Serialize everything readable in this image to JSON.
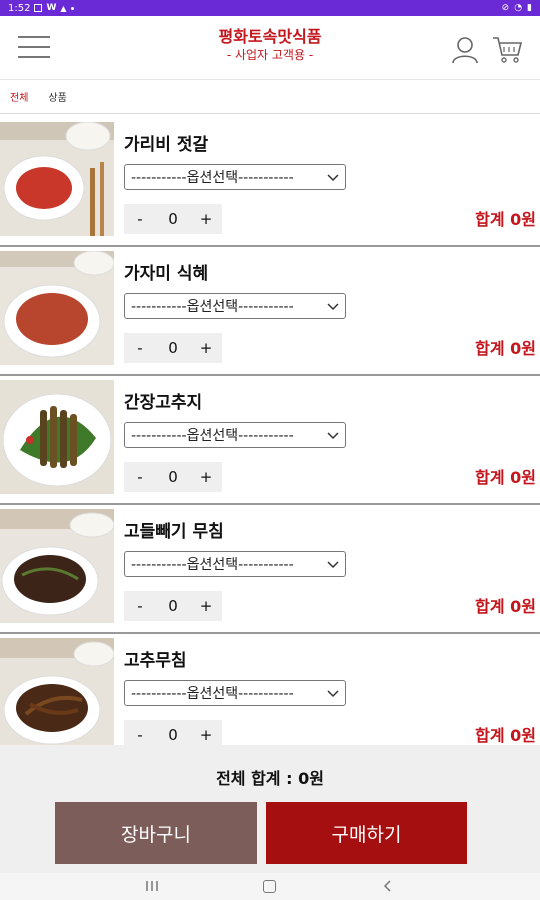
{
  "status_bar": {
    "time": "1:52",
    "indicators": [
      "image-icon",
      "w-icon",
      "dot-icon",
      "mute-icon",
      "wifi-icon",
      "battery-icon"
    ]
  },
  "header": {
    "title": "평화토속맛식품",
    "subtitle": "- 사업자 고객용 -",
    "icons": [
      "hamburger-menu-icon",
      "user-icon",
      "cart-icon"
    ]
  },
  "tabs": [
    {
      "label": "전체",
      "active": true
    },
    {
      "label": "상품",
      "active": false
    }
  ],
  "products": [
    {
      "name": "가리비 젓갈",
      "option": "-----------옵션선택-----------",
      "minus": "-",
      "qty": "0",
      "plus": "+",
      "subtotal": "합계 0원",
      "food_color": "#c8372a"
    },
    {
      "name": "가자미 식혜",
      "option": "-----------옵션선택-----------",
      "minus": "-",
      "qty": "0",
      "plus": "+",
      "subtotal": "합계 0원",
      "food_color": "#b8452d"
    },
    {
      "name": "간장고추지",
      "option": "-----------옵션선택-----------",
      "minus": "-",
      "qty": "0",
      "plus": "+",
      "subtotal": "합계 0원",
      "food_color": "#5a4420"
    },
    {
      "name": "고들빼기 무침",
      "option": "-----------옵션선택-----------",
      "minus": "-",
      "qty": "0",
      "plus": "+",
      "subtotal": "합계 0원",
      "food_color": "#3c2418"
    },
    {
      "name": "고추무침",
      "option": "-----------옵션선택-----------",
      "minus": "-",
      "qty": "0",
      "plus": "+",
      "subtotal": "합계 0원",
      "food_color": "#4a2a16"
    }
  ],
  "bottom": {
    "total": "전체 합계 : 0원",
    "cart_label": "장바구니",
    "buy_label": "구매하기"
  },
  "colors": {
    "accent": "#c4161c",
    "cart_button": "#7d5d5a",
    "buy_button": "#a50f0f",
    "status_bar": "#6a2bd6"
  }
}
